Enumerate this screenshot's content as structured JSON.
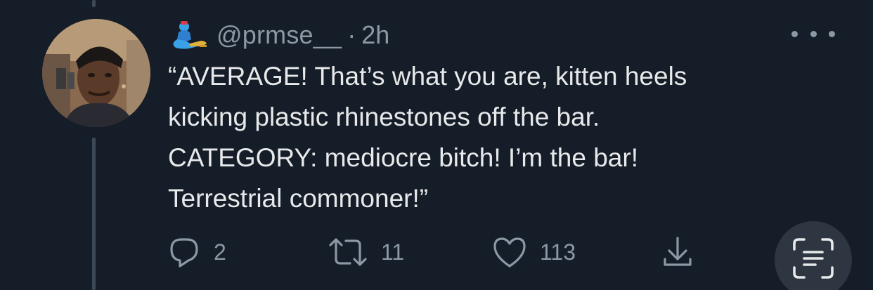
{
  "tweet": {
    "handle": "@prmse__",
    "separator": "·",
    "time": "2h",
    "text_lines": [
      "“AVERAGE! That’s what you are, kitten heels",
      "kicking plastic rhinestones off the bar.",
      "CATEGORY: mediocre bitch! I’m the bar!",
      "Terrestrial commoner!”"
    ],
    "display_name_icon": "genie-icon"
  },
  "actions": {
    "reply_count": "2",
    "retweet_count": "11",
    "like_count": "113"
  },
  "icons": {
    "reply": "reply-icon",
    "retweet": "retweet-icon",
    "like": "heart-icon",
    "share": "share-icon",
    "more": "more-icon",
    "scan": "text-scan-icon"
  },
  "colors": {
    "background": "#151d28",
    "primary_text": "#e7e9ea",
    "secondary_text": "#8b98a5",
    "thread_line": "#3d4956",
    "scan_button": "#2e3741"
  }
}
